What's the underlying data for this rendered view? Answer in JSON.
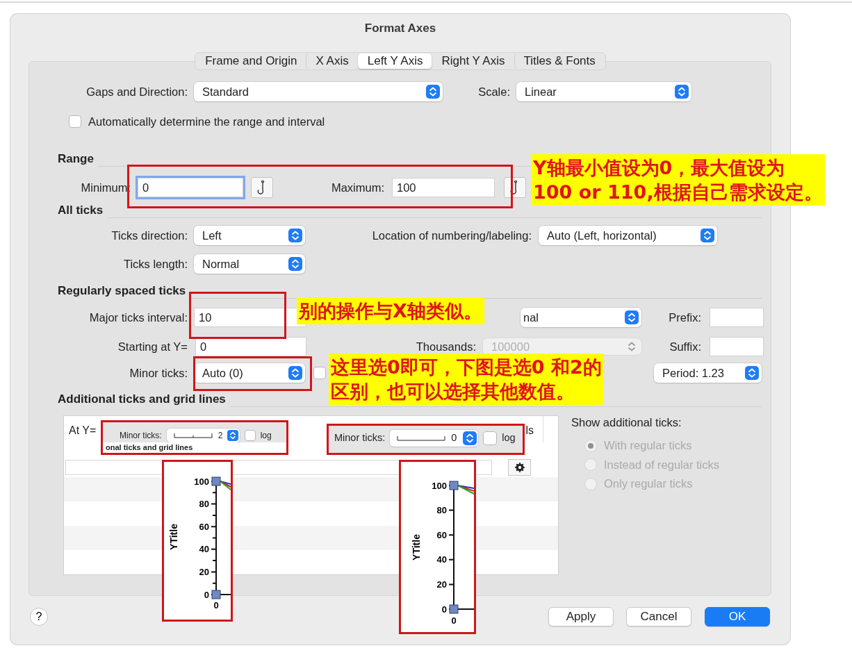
{
  "window": {
    "title": "Format Axes"
  },
  "tabs": [
    {
      "label": "Frame and Origin",
      "selected": false
    },
    {
      "label": "X Axis",
      "selected": false
    },
    {
      "label": "Left Y Axis",
      "selected": true
    },
    {
      "label": "Right Y Axis",
      "selected": false
    },
    {
      "label": "Titles & Fonts",
      "selected": false
    }
  ],
  "general": {
    "gaps_label": "Gaps and Direction:",
    "gaps_value": "Standard",
    "scale_label": "Scale:",
    "scale_value": "Linear",
    "auto_range": {
      "label": "Automatically determine the range and interval",
      "checked": false
    }
  },
  "range": {
    "heading": "Range",
    "min_label": "Minimum:",
    "min_value": "0",
    "min_focused": true,
    "max_label": "Maximum:",
    "max_value": "100"
  },
  "all_ticks": {
    "heading": "All ticks",
    "direction_label": "Ticks direction:",
    "direction_value": "Left",
    "location_label": "Location of numbering/labeling:",
    "location_value": "Auto (Left, horizontal)",
    "length_label": "Ticks length:",
    "length_value": "Normal"
  },
  "regular_ticks": {
    "heading": "Regularly spaced ticks",
    "interval_label": "Major ticks interval:",
    "interval_value": "10",
    "format_value": "nal",
    "prefix_label": "Prefix:",
    "start_label": "Starting at Y=",
    "start_value": "0",
    "thousands_label": "Thousands:",
    "thousands_value": "100000",
    "thousands_disabled": true,
    "suffix_label": "Suffix:",
    "minor_label": "Minor ticks:",
    "minor_value": "Auto (0)",
    "minor_option_checked": false,
    "period_value": "Period: 1.23"
  },
  "additional": {
    "heading": "Additional ticks and grid lines",
    "table": {
      "columns": [
        "At Y=",
        "ls"
      ]
    },
    "show_label": "Show additional ticks:",
    "options": [
      {
        "label": "With regular ticks",
        "selected": true,
        "disabled": true
      },
      {
        "label": "Instead of regular ticks",
        "selected": false,
        "disabled": true
      },
      {
        "label": "Only regular ticks",
        "selected": false,
        "disabled": true
      }
    ]
  },
  "help": {
    "label": "?"
  },
  "buttons": [
    {
      "label": "Apply",
      "kind": "default"
    },
    {
      "label": "Cancel",
      "kind": "default"
    },
    {
      "label": "OK",
      "kind": "primary"
    }
  ],
  "insets": [
    {
      "kind": "with-minor",
      "label": "Minor ticks:",
      "value": "2",
      "log_label": "log",
      "log_checked": false,
      "caption": "onal ticks and grid lines"
    },
    {
      "kind": "plain",
      "label": "Minor ticks:",
      "value": "0",
      "log_label": "log",
      "log_checked": false
    }
  ],
  "axis_snapshots": [
    {
      "title": "YTitle",
      "tick_labels": [
        "100",
        "80",
        "60",
        "40",
        "20",
        "0"
      ],
      "x_label": "0",
      "minor_ticks": true
    },
    {
      "title": "YTitle",
      "tick_labels": [
        "100",
        "80",
        "60",
        "40",
        "20",
        "0"
      ],
      "x_label": "0",
      "minor_ticks": false
    }
  ],
  "annotations": [
    {
      "lines": [
        "Y轴最小值设为0，最大值设为",
        "100 or 110,根据自己需求设定。"
      ]
    },
    {
      "lines": [
        "别的操作与X轴类似。"
      ]
    },
    {
      "lines": [
        "这里选0即可，下图是选0 和2的",
        "区别，也可以选择其他数值。"
      ]
    }
  ]
}
